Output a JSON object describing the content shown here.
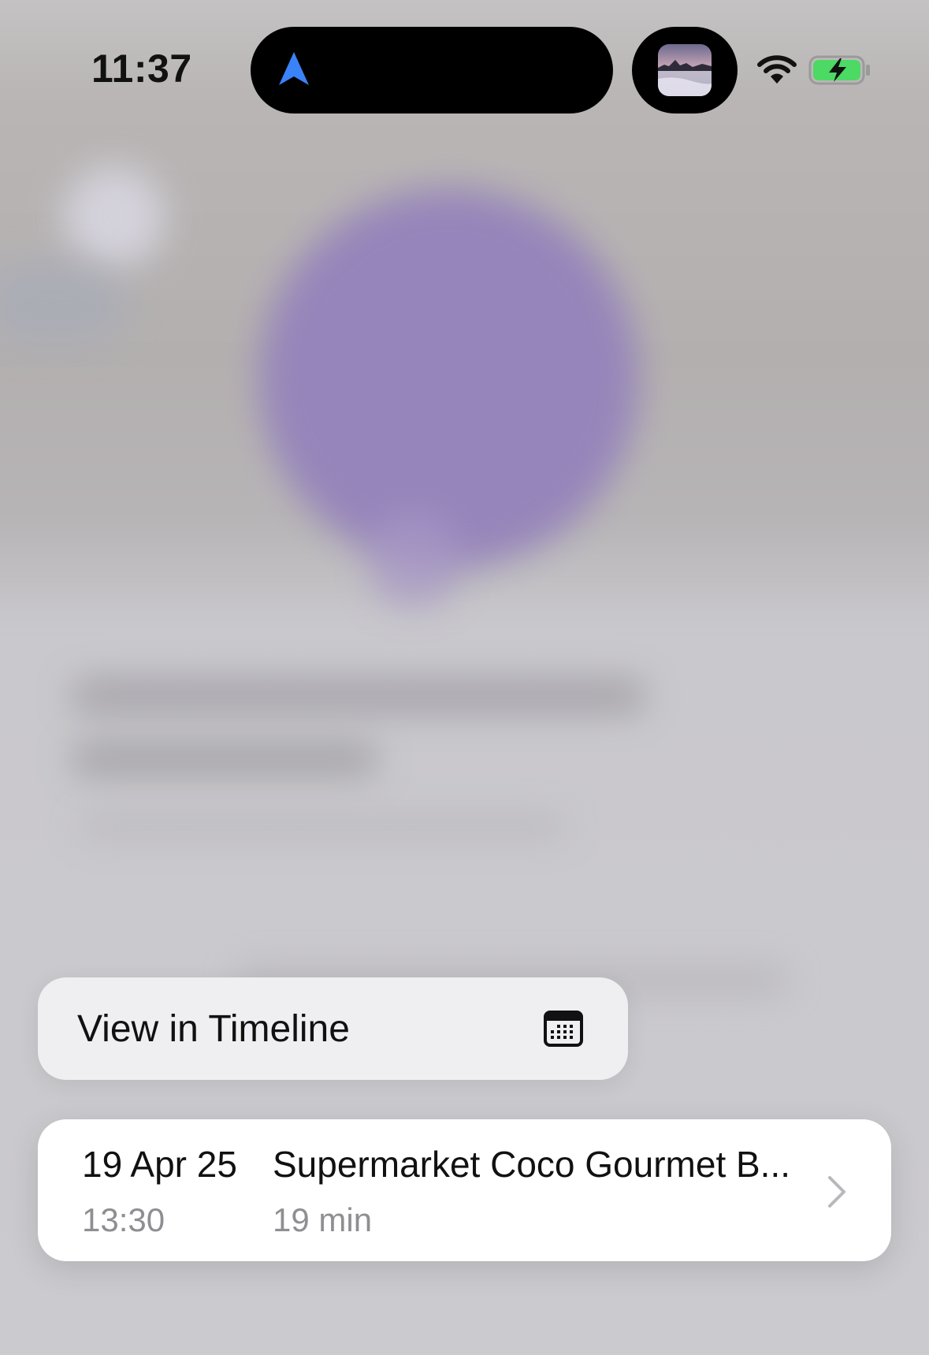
{
  "status_bar": {
    "time": "11:37",
    "icons": [
      "navigation-arrow-icon",
      "photo-thumbnail",
      "wifi-icon",
      "battery-charging-icon"
    ],
    "nav_arrow_color": "#3a82f7",
    "battery_color": "#4cd964"
  },
  "menu": {
    "view_in_timeline_label": "View in Timeline",
    "icon": "calendar-icon"
  },
  "visit": {
    "date": "19 Apr 25",
    "time": "13:30",
    "place": "Supermarket Coco Gourmet B...",
    "duration": "19 min",
    "icon": "chevron-right-icon"
  },
  "colors": {
    "pin_purple": "#9583bb",
    "card_bg": "#ffffff",
    "menu_bg": "#efeff1"
  }
}
